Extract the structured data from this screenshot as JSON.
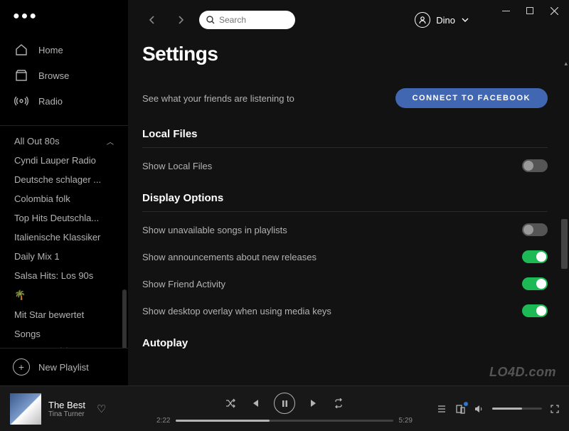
{
  "window": {
    "menu_dots": "●●●"
  },
  "search": {
    "placeholder": "Search"
  },
  "user": {
    "name": "Dino"
  },
  "nav": {
    "home": "Home",
    "browse": "Browse",
    "radio": "Radio"
  },
  "playlists": [
    "All Out 80s",
    "Cyndi Lauper Radio",
    "Deutsche schlager ...",
    "Colombia folk",
    "Top Hits Deutschla...",
    "Italienische Klassiker",
    "Daily Mix 1",
    "Salsa Hits: Los 90s",
    "🌴",
    "Mit Star bewertet",
    "Songs"
  ],
  "new_playlist_label": "New Playlist",
  "settings": {
    "title": "Settings",
    "friends_text": "See what your friends are listening to",
    "fb_button": "CONNECT TO FACEBOOK",
    "sections": {
      "local_files": {
        "head": "Local Files",
        "items": [
          {
            "label": "Show Local Files",
            "on": false
          }
        ]
      },
      "display_options": {
        "head": "Display Options",
        "items": [
          {
            "label": "Show unavailable songs in playlists",
            "on": false
          },
          {
            "label": "Show announcements about new releases",
            "on": true
          },
          {
            "label": "Show Friend Activity",
            "on": true
          },
          {
            "label": "Show desktop overlay when using media keys",
            "on": true
          }
        ]
      },
      "autoplay": {
        "head": "Autoplay"
      }
    }
  },
  "player": {
    "track_title": "The Best",
    "track_artist": "Tina Turner",
    "time_current": "2:22",
    "time_total": "5:29",
    "progress_pct": 43
  },
  "watermark": "LO4D.com"
}
